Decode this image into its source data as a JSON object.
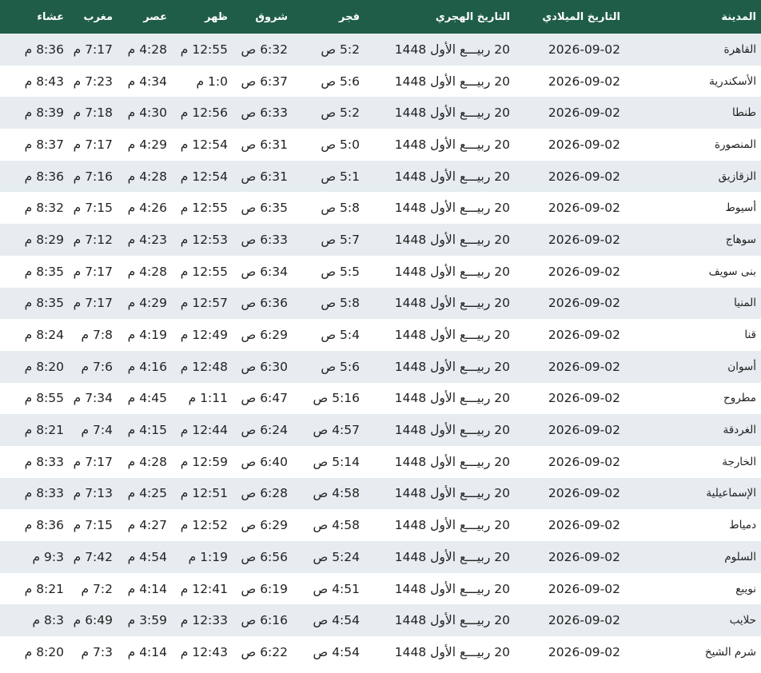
{
  "headers": {
    "city": "المدينة",
    "gregorian_date": "التاريخ الميلادي",
    "hijri_date": "التاريخ الهجري",
    "fajr": "فجر",
    "shuruq": "شروق",
    "dhuhr": "ظهر",
    "asr": "عصر",
    "maghrib": "مغرب",
    "isha": "عشاء"
  },
  "rows": [
    {
      "city": "القاهرة",
      "greg": "2026-09-02",
      "hijri": "20 ربيـــع الأول 1448",
      "fajr": "5:2 ص",
      "shuruq": "6:32 ص",
      "dhuhr": "12:55 م",
      "asr": "4:28 م",
      "maghrib": "7:17 م",
      "isha": "8:36 م"
    },
    {
      "city": "الأسكندرية",
      "greg": "2026-09-02",
      "hijri": "20 ربيـــع الأول 1448",
      "fajr": "5:6 ص",
      "shuruq": "6:37 ص",
      "dhuhr": "1:0 م",
      "asr": "4:34 م",
      "maghrib": "7:23 م",
      "isha": "8:43 م"
    },
    {
      "city": "طنطا",
      "greg": "2026-09-02",
      "hijri": "20 ربيـــع الأول 1448",
      "fajr": "5:2 ص",
      "shuruq": "6:33 ص",
      "dhuhr": "12:56 م",
      "asr": "4:30 م",
      "maghrib": "7:18 م",
      "isha": "8:39 م"
    },
    {
      "city": "المنصورة",
      "greg": "2026-09-02",
      "hijri": "20 ربيـــع الأول 1448",
      "fajr": "5:0 ص",
      "shuruq": "6:31 ص",
      "dhuhr": "12:54 م",
      "asr": "4:29 م",
      "maghrib": "7:17 م",
      "isha": "8:37 م"
    },
    {
      "city": "الزقازيق",
      "greg": "2026-09-02",
      "hijri": "20 ربيـــع الأول 1448",
      "fajr": "5:1 ص",
      "shuruq": "6:31 ص",
      "dhuhr": "12:54 م",
      "asr": "4:28 م",
      "maghrib": "7:16 م",
      "isha": "8:36 م"
    },
    {
      "city": "أسيوط",
      "greg": "2026-09-02",
      "hijri": "20 ربيـــع الأول 1448",
      "fajr": "5:8 ص",
      "shuruq": "6:35 ص",
      "dhuhr": "12:55 م",
      "asr": "4:26 م",
      "maghrib": "7:15 م",
      "isha": "8:32 م"
    },
    {
      "city": "سوهاج",
      "greg": "2026-09-02",
      "hijri": "20 ربيـــع الأول 1448",
      "fajr": "5:7 ص",
      "shuruq": "6:33 ص",
      "dhuhr": "12:53 م",
      "asr": "4:23 م",
      "maghrib": "7:12 م",
      "isha": "8:29 م"
    },
    {
      "city": "بنى سويف",
      "greg": "2026-09-02",
      "hijri": "20 ربيـــع الأول 1448",
      "fajr": "5:5 ص",
      "shuruq": "6:34 ص",
      "dhuhr": "12:55 م",
      "asr": "4:28 م",
      "maghrib": "7:17 م",
      "isha": "8:35 م"
    },
    {
      "city": "المنيا",
      "greg": "2026-09-02",
      "hijri": "20 ربيـــع الأول 1448",
      "fajr": "5:8 ص",
      "shuruq": "6:36 ص",
      "dhuhr": "12:57 م",
      "asr": "4:29 م",
      "maghrib": "7:17 م",
      "isha": "8:35 م"
    },
    {
      "city": "قنا",
      "greg": "2026-09-02",
      "hijri": "20 ربيـــع الأول 1448",
      "fajr": "5:4 ص",
      "shuruq": "6:29 ص",
      "dhuhr": "12:49 م",
      "asr": "4:19 م",
      "maghrib": "7:8 م",
      "isha": "8:24 م"
    },
    {
      "city": "أسوان",
      "greg": "2026-09-02",
      "hijri": "20 ربيـــع الأول 1448",
      "fajr": "5:6 ص",
      "shuruq": "6:30 ص",
      "dhuhr": "12:48 م",
      "asr": "4:16 م",
      "maghrib": "7:6 م",
      "isha": "8:20 م"
    },
    {
      "city": "مطروح",
      "greg": "2026-09-02",
      "hijri": "20 ربيـــع الأول 1448",
      "fajr": "5:16 ص",
      "shuruq": "6:47 ص",
      "dhuhr": "1:11 م",
      "asr": "4:45 م",
      "maghrib": "7:34 م",
      "isha": "8:55 م"
    },
    {
      "city": "الغردقة",
      "greg": "2026-09-02",
      "hijri": "20 ربيـــع الأول 1448",
      "fajr": "4:57 ص",
      "shuruq": "6:24 ص",
      "dhuhr": "12:44 م",
      "asr": "4:15 م",
      "maghrib": "7:4 م",
      "isha": "8:21 م"
    },
    {
      "city": "الخارجة",
      "greg": "2026-09-02",
      "hijri": "20 ربيـــع الأول 1448",
      "fajr": "5:14 ص",
      "shuruq": "6:40 ص",
      "dhuhr": "12:59 م",
      "asr": "4:28 م",
      "maghrib": "7:17 م",
      "isha": "8:33 م"
    },
    {
      "city": "الإسماعيلية",
      "greg": "2026-09-02",
      "hijri": "20 ربيـــع الأول 1448",
      "fajr": "4:58 ص",
      "shuruq": "6:28 ص",
      "dhuhr": "12:51 م",
      "asr": "4:25 م",
      "maghrib": "7:13 م",
      "isha": "8:33 م"
    },
    {
      "city": "دمياط",
      "greg": "2026-09-02",
      "hijri": "20 ربيـــع الأول 1448",
      "fajr": "4:58 ص",
      "shuruq": "6:29 ص",
      "dhuhr": "12:52 م",
      "asr": "4:27 م",
      "maghrib": "7:15 م",
      "isha": "8:36 م"
    },
    {
      "city": "السلوم",
      "greg": "2026-09-02",
      "hijri": "20 ربيـــع الأول 1448",
      "fajr": "5:24 ص",
      "shuruq": "6:56 ص",
      "dhuhr": "1:19 م",
      "asr": "4:54 م",
      "maghrib": "7:42 م",
      "isha": "9:3 م"
    },
    {
      "city": "نويبع",
      "greg": "2026-09-02",
      "hijri": "20 ربيـــع الأول 1448",
      "fajr": "4:51 ص",
      "shuruq": "6:19 ص",
      "dhuhr": "12:41 م",
      "asr": "4:14 م",
      "maghrib": "7:2 م",
      "isha": "8:21 م"
    },
    {
      "city": "حلايب",
      "greg": "2026-09-02",
      "hijri": "20 ربيـــع الأول 1448",
      "fajr": "4:54 ص",
      "shuruq": "6:16 ص",
      "dhuhr": "12:33 م",
      "asr": "3:59 م",
      "maghrib": "6:49 م",
      "isha": "8:3 م"
    },
    {
      "city": "شرم الشيخ",
      "greg": "2026-09-02",
      "hijri": "20 ربيـــع الأول 1448",
      "fajr": "4:54 ص",
      "shuruq": "6:22 ص",
      "dhuhr": "12:43 م",
      "asr": "4:14 م",
      "maghrib": "7:3 م",
      "isha": "8:20 م"
    }
  ]
}
